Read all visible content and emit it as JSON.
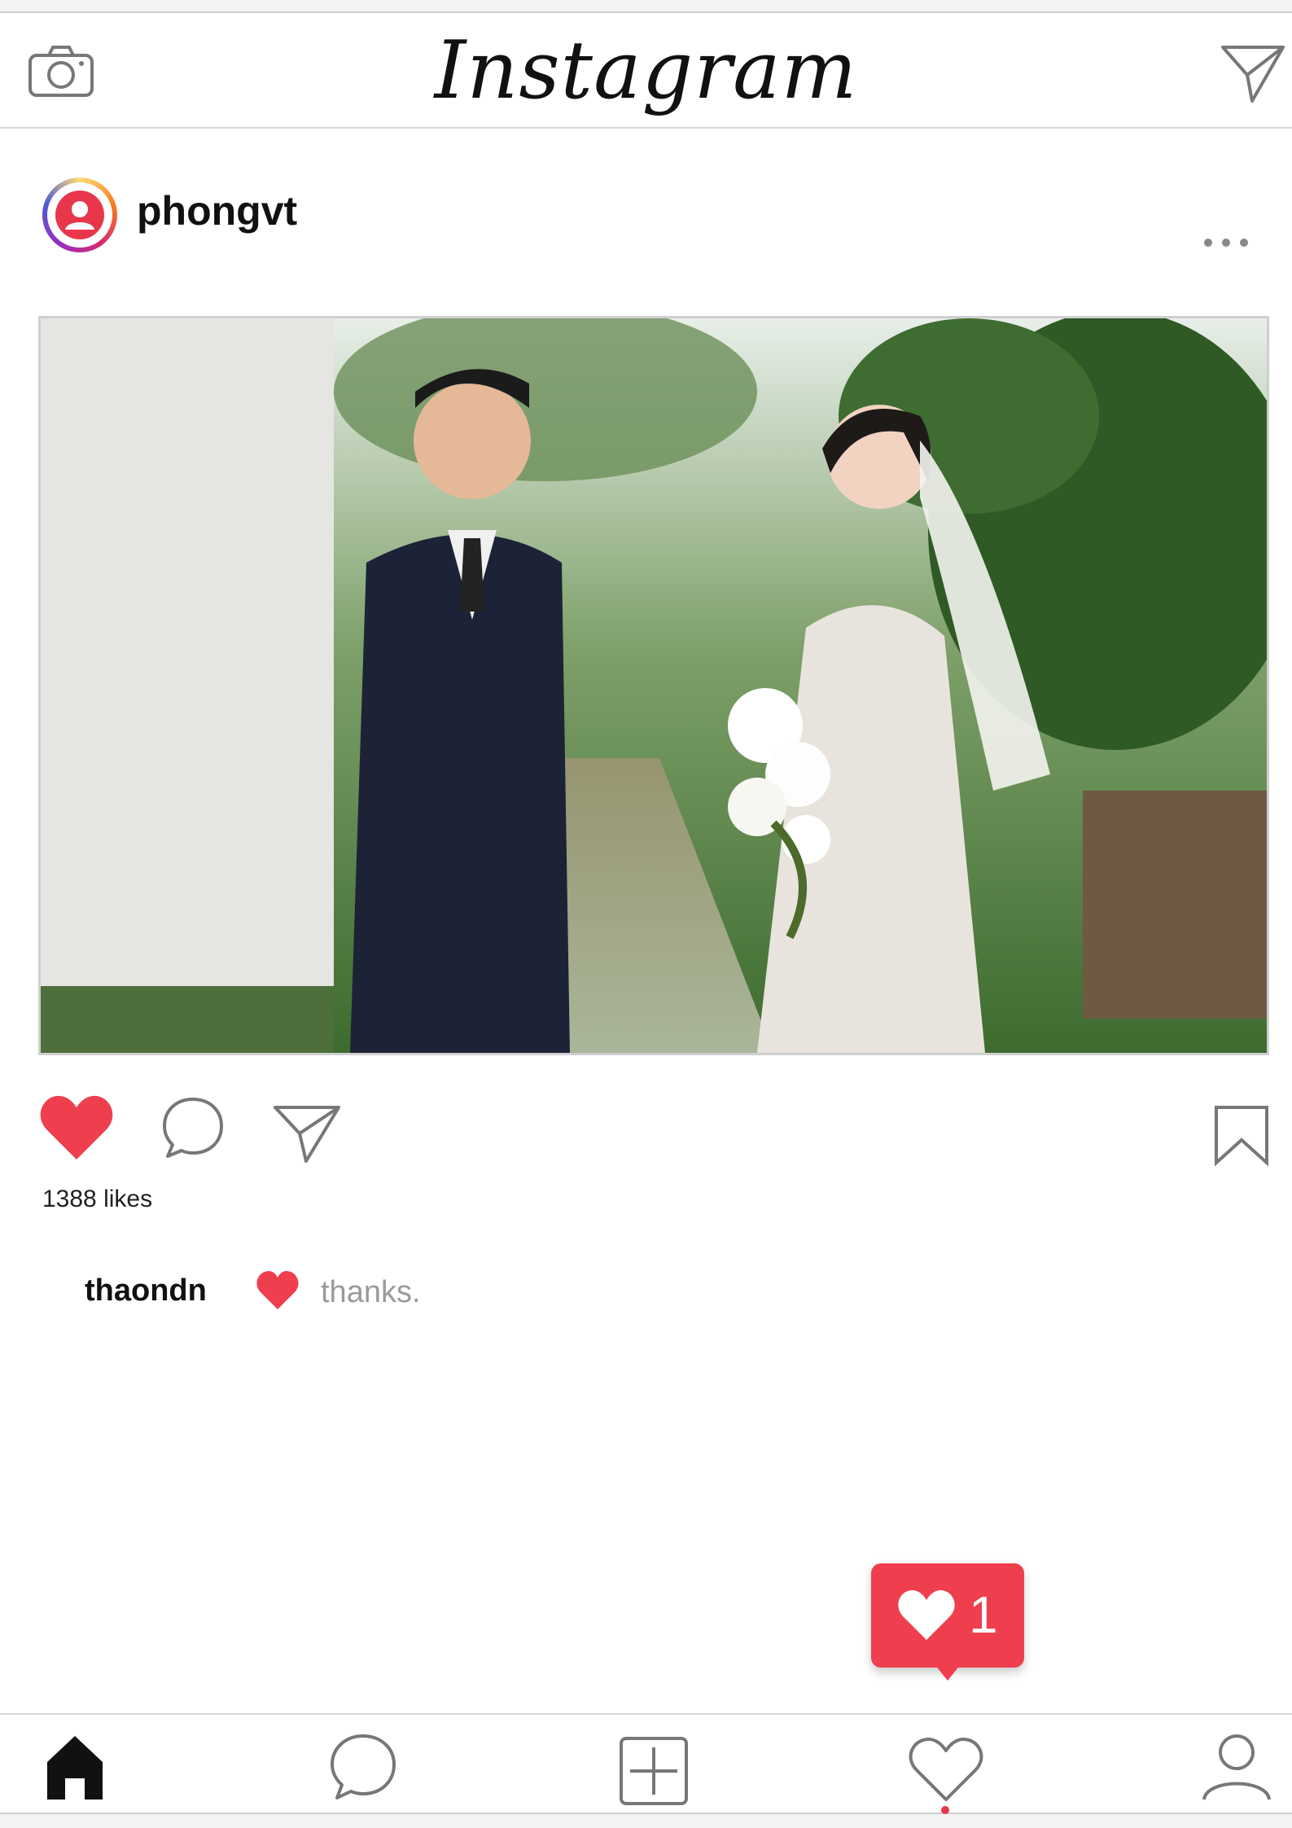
{
  "app": {
    "brand": "Instagram"
  },
  "icons": {
    "camera": "camera-icon",
    "direct": "paper-plane-icon",
    "more": "ellipsis-icon",
    "like": "heart-icon",
    "comment": "comment-bubble-icon",
    "share": "paper-plane-icon",
    "save": "bookmark-icon",
    "home": "home-icon",
    "search": "speech-bubble-icon",
    "add": "plus-square-icon",
    "activity": "heart-outline-icon",
    "profile": "person-icon"
  },
  "post": {
    "username": "phongvt",
    "photo_alt": "wedding-couple-photo",
    "likes_text": "1388 likes",
    "liked": true,
    "comment": {
      "username": "thaondn",
      "text": "thanks."
    }
  },
  "notification": {
    "type": "likes",
    "count": "1"
  },
  "colors": {
    "like_red": "#ef3f4f",
    "border": "#cfcfcf",
    "muted_text": "#9a9a9a"
  }
}
